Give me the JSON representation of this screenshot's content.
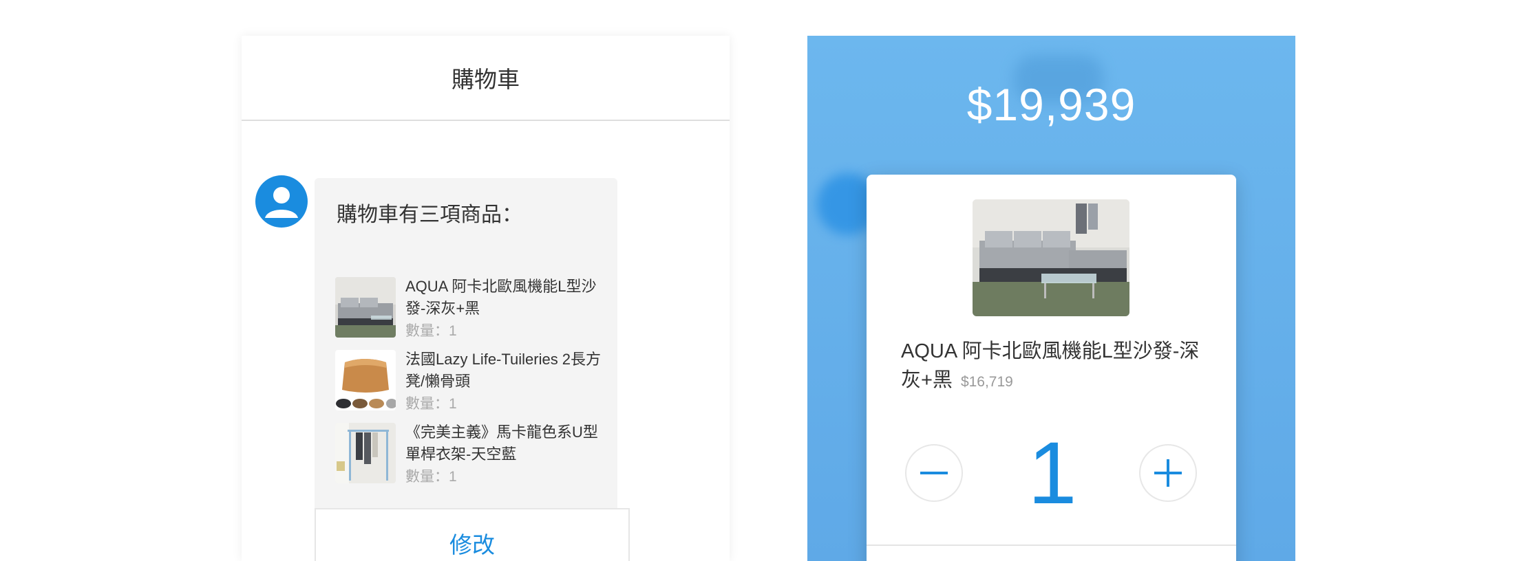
{
  "left": {
    "header_title": "購物車",
    "bubble_title": "購物車有三項商品：",
    "items": [
      {
        "name": "AQUA 阿卡北歐風機能L型沙發-深灰+黑",
        "qty": "數量：1",
        "thumb_icon": "sofa-image"
      },
      {
        "name": "法國Lazy Life-Tuileries 2長方凳/懶骨頭",
        "qty": "數量：1",
        "thumb_icon": "ottoman-image"
      },
      {
        "name": "《完美主義》馬卡龍色系U型單桿衣架-天空藍",
        "qty": "數量：1",
        "thumb_icon": "clothes-rack-image"
      }
    ],
    "edit_label": "修改",
    "accent_color": "#1a8cdf"
  },
  "right": {
    "total": "$19,939",
    "product_name": "AQUA 阿卡北歐風機能L型沙發-深灰+黑",
    "product_price": "$16,719",
    "quantity": "1",
    "minus_icon": "minus-icon",
    "plus_icon": "plus-icon",
    "background_color": "#65b0ea"
  }
}
